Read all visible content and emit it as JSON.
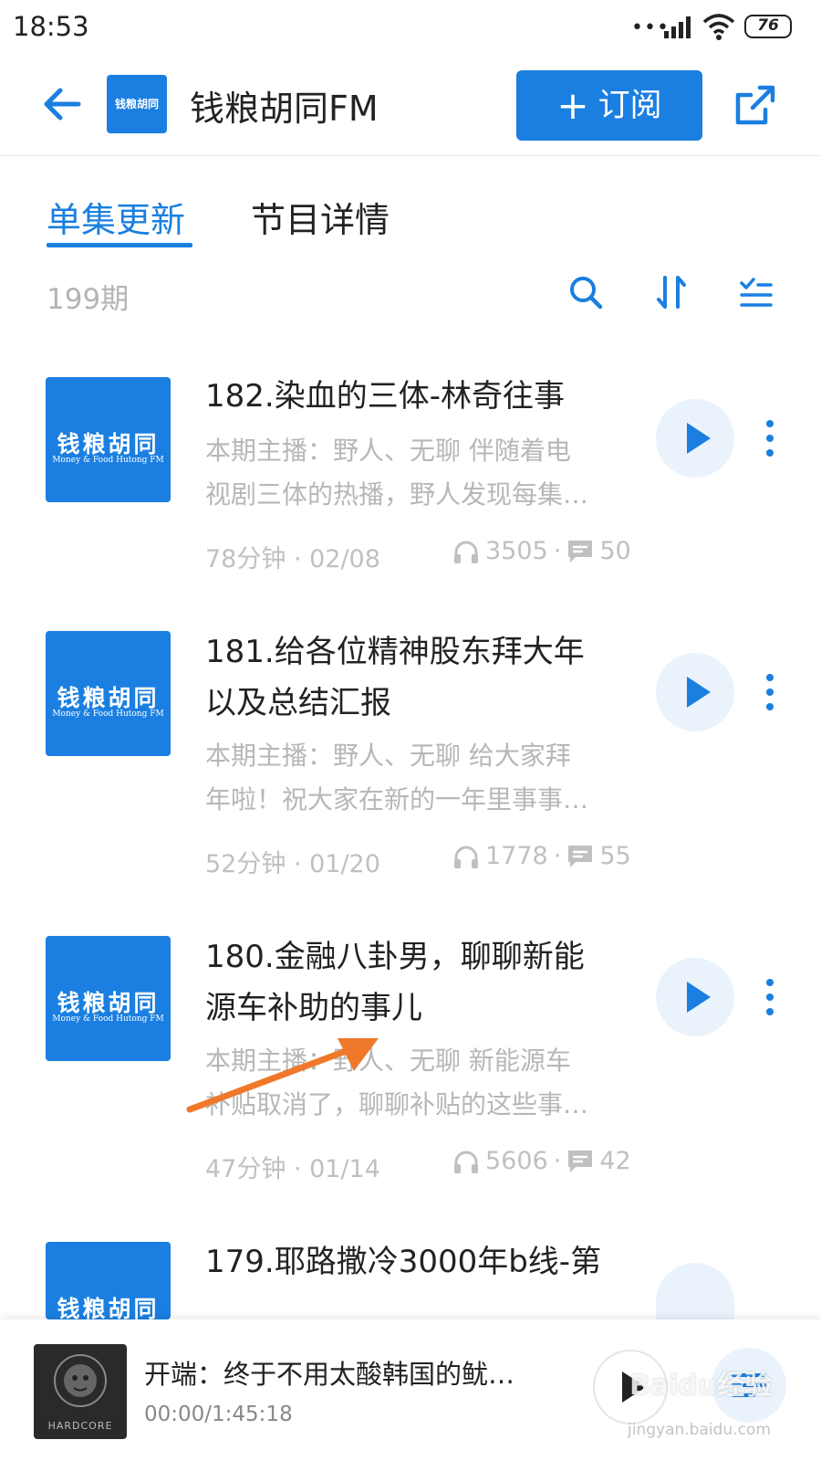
{
  "status_bar": {
    "time": "18:53",
    "battery": "76"
  },
  "header": {
    "title": "钱粮胡同FM",
    "subscribe_label": "订阅",
    "colors": {
      "accent": "#1a7fe0"
    }
  },
  "tabs": [
    {
      "label": "单集更新",
      "active": true
    },
    {
      "label": "节目详情",
      "active": false
    }
  ],
  "toolbar": {
    "episode_count": "199期"
  },
  "cover": {
    "cn": "钱粮胡同",
    "en": "Money & Food Hutong FM"
  },
  "episodes": [
    {
      "title": "182.染血的三体-林奇往事",
      "desc_line1": "本期主播：野人、无聊 伴随着电",
      "desc_line2": "视剧三体的热播，野人发现每集…",
      "meta": "78分钟 · 02/08",
      "plays": "3505",
      "comments": "50"
    },
    {
      "title_line1": "181.给各位精神股东拜大年",
      "title_line2": "以及总结汇报",
      "desc_line1": "本期主播：野人、无聊 给大家拜",
      "desc_line2": "年啦！祝大家在新的一年里事事…",
      "meta": "52分钟 · 01/20",
      "plays": "1778",
      "comments": "55"
    },
    {
      "title_line1": "180.金融八卦男，聊聊新能",
      "title_line2": "源车补助的事儿",
      "desc_line1": "本期主播：野人、无聊 新能源车",
      "desc_line2": "补贴取消了，聊聊补贴的这些事…",
      "meta": "47分钟 · 01/14",
      "plays": "5606",
      "comments": "42"
    },
    {
      "title": "179.耶路撒冷3000年b线-第"
    }
  ],
  "player": {
    "title": "开端：终于不用太酸韩国的鱿…",
    "time": "00:00/1:45:18",
    "cover_text": "HARDCORE"
  },
  "watermark": {
    "brand": "Baidu经验",
    "url": "jingyan.baidu.com"
  }
}
